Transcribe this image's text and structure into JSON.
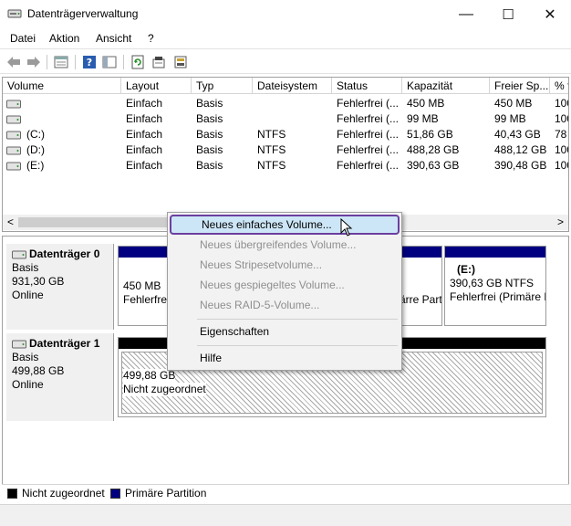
{
  "window": {
    "title": "Datenträgerverwaltung",
    "minimize_glyph": "—",
    "maximize_glyph": "☐",
    "close_glyph": "✕"
  },
  "menu": [
    "Datei",
    "Aktion",
    "Ansicht",
    "?"
  ],
  "toolbar_icons": [
    "back-arrow-icon",
    "forward-arrow-icon",
    "properties-list-icon",
    "help-icon",
    "show-hide-icon",
    "refresh-icon",
    "export-icon",
    "settings-icon"
  ],
  "volume_list": {
    "columns": [
      "Volume",
      "Layout",
      "Typ",
      "Dateisystem",
      "Status",
      "Kapazität",
      "Freier Sp...",
      "% f"
    ],
    "rows": [
      [
        "",
        "Einfach",
        "Basis",
        "",
        "Fehlerfrei (...",
        "450 MB",
        "450 MB",
        "100"
      ],
      [
        "",
        "Einfach",
        "Basis",
        "",
        "Fehlerfrei (...",
        "99 MB",
        "99 MB",
        "100"
      ],
      [
        "(C:)",
        "Einfach",
        "Basis",
        "NTFS",
        "Fehlerfrei (...",
        "51,86 GB",
        "40,43 GB",
        "78"
      ],
      [
        "(D:)",
        "Einfach",
        "Basis",
        "NTFS",
        "Fehlerfrei (...",
        "488,28 GB",
        "488,12 GB",
        "100"
      ],
      [
        "(E:)",
        "Einfach",
        "Basis",
        "NTFS",
        "Fehlerfrei (...",
        "390,63 GB",
        "390,48 GB",
        "100"
      ]
    ],
    "scroll_left": "<",
    "scroll_right": ">"
  },
  "disks": [
    {
      "name": "Datenträger 0",
      "type": "Basis",
      "size": "931,30 GB",
      "state": "Online",
      "partitions": [
        {
          "line1": "450 MB",
          "line2": "Fehlerfre"
        },
        {
          "line1": "",
          "line2": "ärre Part"
        },
        {
          "line1": "(E:)",
          "line1b": "390,63 GB NTFS",
          "line2": "Fehlerfrei (Primäre Part"
        }
      ]
    },
    {
      "name": "Datenträger 1",
      "type": "Basis",
      "size": "499,88 GB",
      "state": "Online",
      "partitions": [
        {
          "line1": "499,88 GB",
          "line2": "Nicht zugeordnet"
        }
      ]
    }
  ],
  "legend": [
    {
      "label": "Nicht zugeordnet",
      "color": "#000000"
    },
    {
      "label": "Primäre Partition",
      "color": "#000080"
    }
  ],
  "context_menu": {
    "items": [
      {
        "label": "Neues einfaches Volume...",
        "enabled": true,
        "highlighted": true
      },
      {
        "label": "Neues übergreifendes Volume...",
        "enabled": false
      },
      {
        "label": "Neues Stripesetvolume...",
        "enabled": false
      },
      {
        "label": "Neues gespiegeltes Volume...",
        "enabled": false
      },
      {
        "label": "Neues RAID-5-Volume...",
        "enabled": false
      },
      {
        "label": "Eigenschaften",
        "enabled": true
      },
      {
        "label": "Hilfe",
        "enabled": true
      }
    ]
  },
  "colors": {
    "primary_partition": "#000080",
    "unallocated": "#000000",
    "highlight_bg": "#cde6f7",
    "highlight_border": "#6b3fa0"
  }
}
